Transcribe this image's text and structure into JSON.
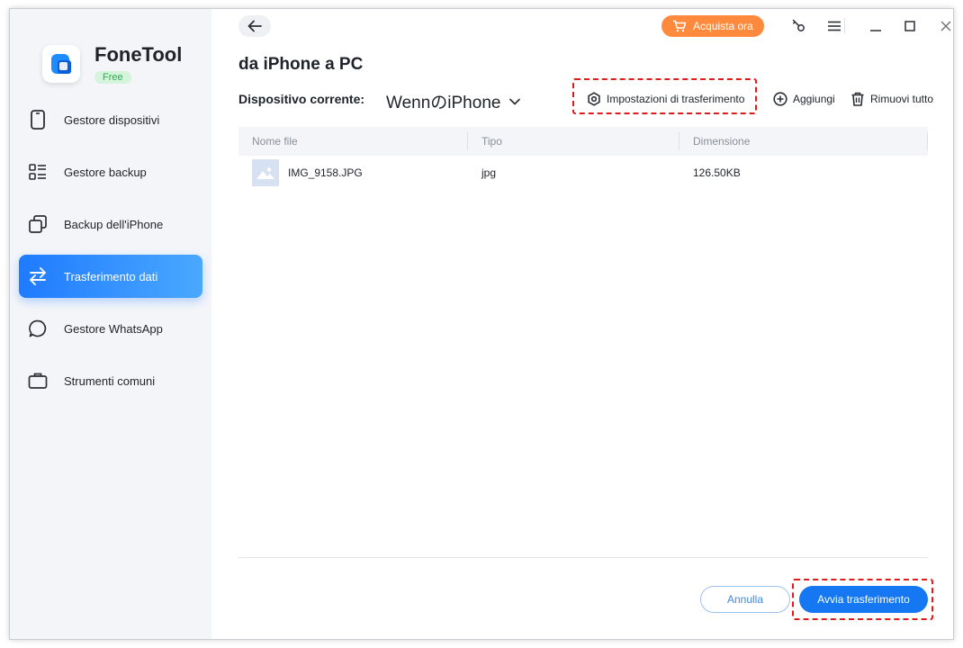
{
  "app": {
    "name": "FoneTool",
    "edition": "Free"
  },
  "sidebar": {
    "items": [
      {
        "label": "Gestore dispositivi",
        "icon": "phone-icon"
      },
      {
        "label": "Gestore backup",
        "icon": "list-icon"
      },
      {
        "label": "Backup dell'iPhone",
        "icon": "copy-icon"
      },
      {
        "label": "Trasferimento dati",
        "icon": "transfer-icon",
        "active": true
      },
      {
        "label": "Gestore WhatsApp",
        "icon": "chat-icon"
      },
      {
        "label": "Strumenti comuni",
        "icon": "toolbox-icon"
      }
    ]
  },
  "topbar": {
    "buy_label": "Acquista ora"
  },
  "page": {
    "title": "da iPhone a PC",
    "device_label": "Dispositivo corrente:",
    "device_name": "WennのiPhone"
  },
  "toolbar": {
    "settings_label": "Impostazioni di trasferimento",
    "add_label": "Aggiungi",
    "remove_all_label": "Rimuovi tutto"
  },
  "table": {
    "columns": [
      "Nome file",
      "Tipo",
      "Dimensione"
    ],
    "rows": [
      {
        "name": "IMG_9158.JPG",
        "type": "jpg",
        "size": "126.50KB"
      }
    ]
  },
  "footer": {
    "cancel_label": "Annulla",
    "start_label": "Avvia trasferimento"
  },
  "colors": {
    "accent": "#1677f2",
    "buy": "#ff8a3d",
    "highlight_dash": "#e01b1b",
    "badge_bg": "#d4f4dc"
  }
}
